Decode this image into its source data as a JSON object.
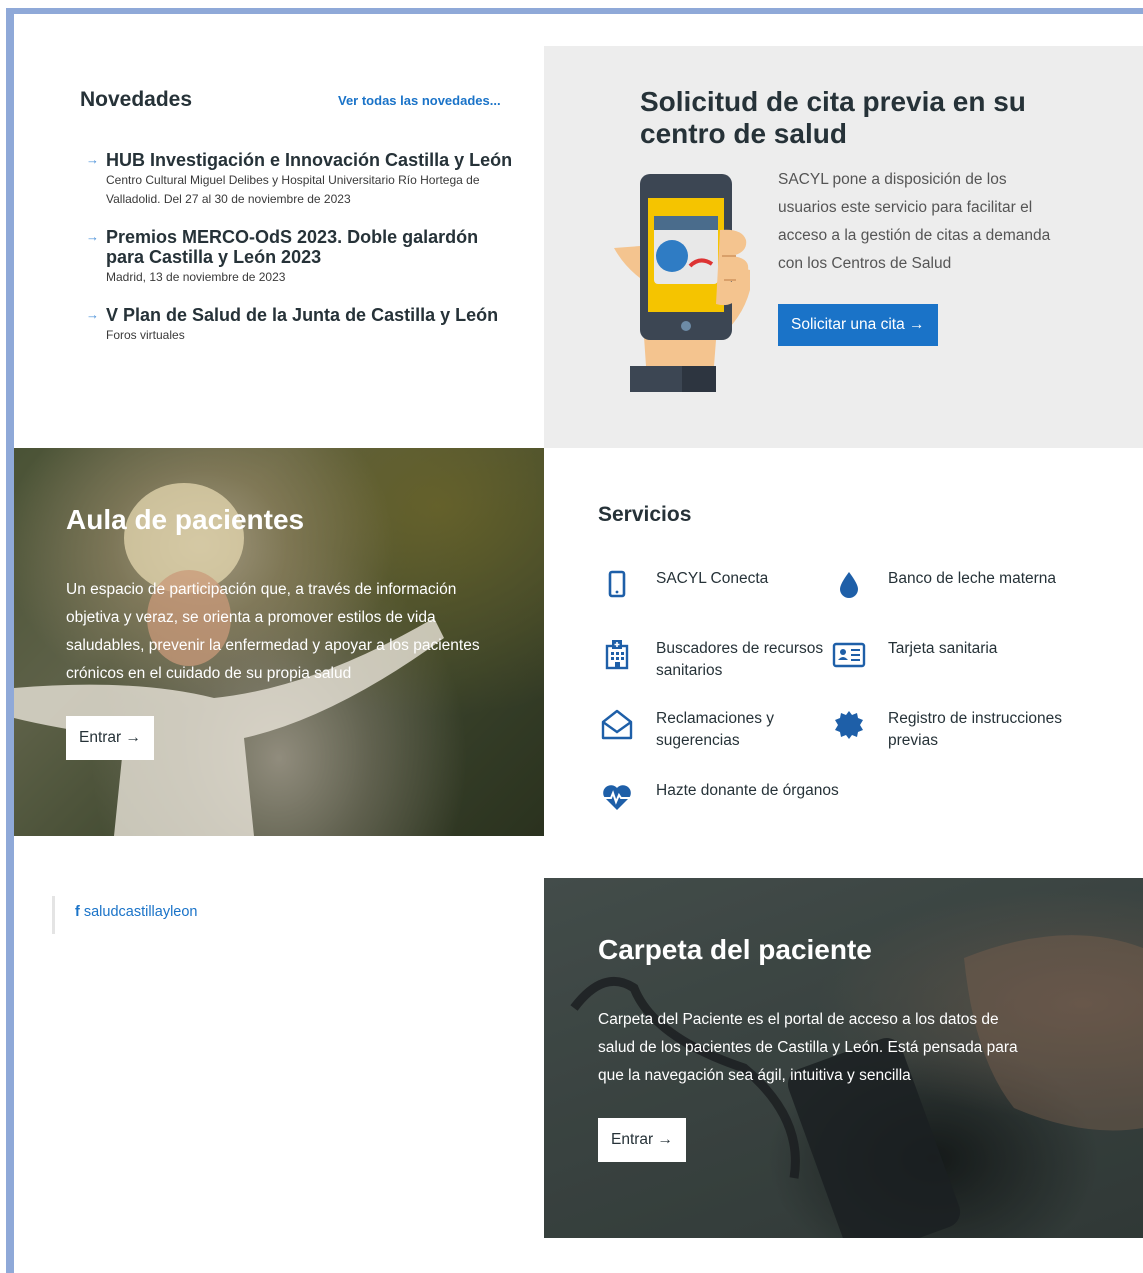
{
  "news": {
    "title": "Novedades",
    "all_link": "Ver todas las novedades...",
    "items": [
      {
        "headline": "HUB Investigación e Innovación Castilla y León",
        "sub": "Centro Cultural Miguel Delibes y Hospital Universitario Río Hortega de Valladolid. Del 27 al 30 de noviembre de 2023"
      },
      {
        "headline": "Premios MERCO-OdS 2023. Doble galardón para Castilla y León 2023",
        "sub": "Madrid, 13 de noviembre de 2023"
      },
      {
        "headline": "V Plan de Salud de la Junta de Castilla y León",
        "sub": "Foros virtuales"
      }
    ]
  },
  "cita": {
    "title": "Solicitud de cita previa en su centro de salud",
    "text": "SACYL pone a disposición de los usuarios este servicio para facilitar el acceso a la gestión de citas a demanda con los Centros de Salud",
    "button": "Solicitar una cita →"
  },
  "aula": {
    "title": "Aula de pacientes",
    "text": "Un espacio de participación que, a través de información objetiva y veraz, se orienta a promover estilos de vida saludables, prevenir la enfermedad y apoyar a los pacientes crónicos en el cuidado de su propia salud",
    "button": "Entrar →"
  },
  "servicios": {
    "title": "Servicios",
    "items": [
      {
        "label": "SACYL Conecta",
        "icon": "mobile-phone-icon"
      },
      {
        "label": "Banco de leche materna",
        "icon": "drop-icon"
      },
      {
        "label": "Buscadores de recursos sanitarios",
        "icon": "hospital-icon"
      },
      {
        "label": "Tarjeta sanitaria",
        "icon": "id-card-icon"
      },
      {
        "label": "Reclamaciones y sugerencias",
        "icon": "envelope-open-icon"
      },
      {
        "label": "Registro de instrucciones previas",
        "icon": "seal-icon"
      },
      {
        "label": "Hazte donante de órganos",
        "icon": "heartbeat-icon"
      }
    ]
  },
  "facebook": {
    "glyph": "f",
    "handle": "saludcastillayleon"
  },
  "carpeta": {
    "title": "Carpeta del paciente",
    "text": "Carpeta del Paciente es el portal de acceso a los datos de salud de los pacientes de Castilla y León. Está pensada para que la navegación sea ágil, intuitiva y sencilla",
    "button": "Entrar →"
  },
  "colors": {
    "accent": "#1a73c8",
    "frame": "#8fa9d8",
    "panel": "#ededed",
    "icon": "#1e5fa8"
  }
}
